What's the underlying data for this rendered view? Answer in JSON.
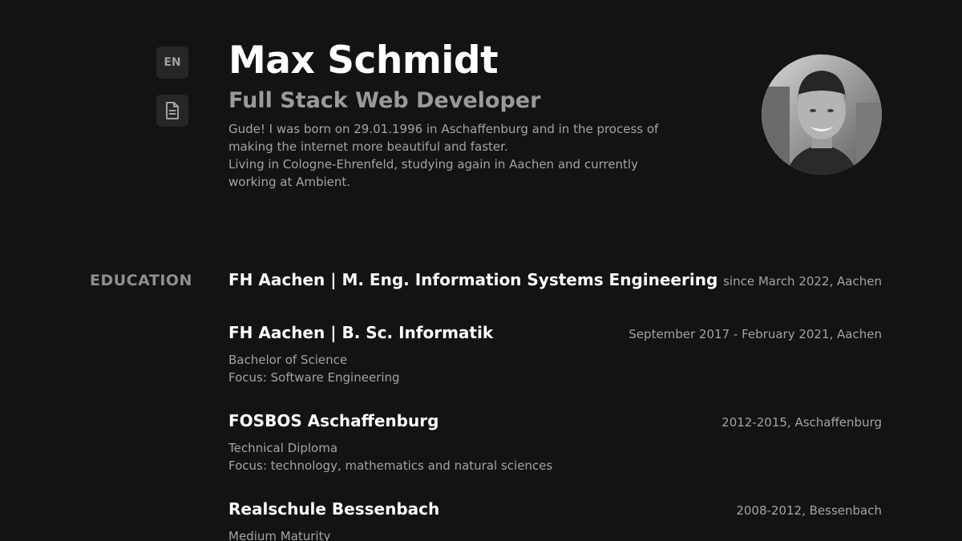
{
  "sidebar": {
    "language_label": "EN",
    "cv_icon": "document-icon"
  },
  "profile": {
    "name": "Max Schmidt",
    "role": "Full Stack Web Developer",
    "bio_line_1": "Gude! I was born on 29.01.1996 in Aschaffenburg and in the process of making the internet more beautiful and faster.",
    "bio_line_2": "Living in Cologne-Ehrenfeld, studying again in Aachen and currently working at Ambient."
  },
  "education": {
    "title": "EDUCATION",
    "entries": [
      {
        "title": "FH Aachen | M. Eng. Information Systems Engineering",
        "meta": "since March 2022, Aachen",
        "lines": []
      },
      {
        "title": "FH Aachen | B. Sc. Informatik",
        "meta": "September 2017 - February 2021, Aachen",
        "lines": [
          "Bachelor of Science",
          "Focus: Software Engineering"
        ]
      },
      {
        "title": "FOSBOS Aschaffenburg",
        "meta": "2012-2015, Aschaffenburg",
        "lines": [
          "Technical Diploma",
          "Focus: technology, mathematics and natural sciences"
        ]
      },
      {
        "title": "Realschule Bessenbach",
        "meta": "2008-2012, Bessenbach",
        "lines": [
          "Medium Maturity"
        ]
      }
    ]
  }
}
